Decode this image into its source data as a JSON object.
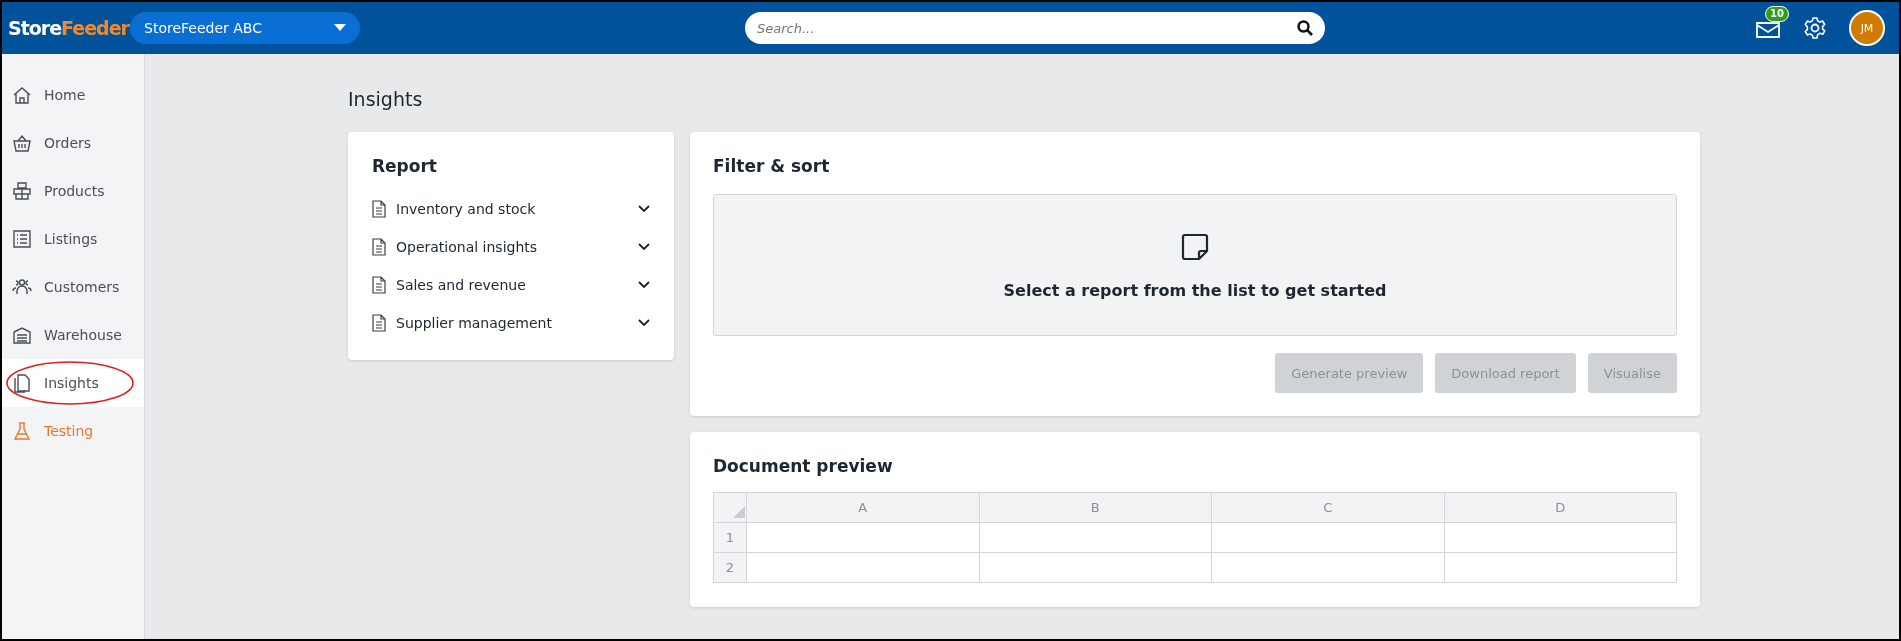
{
  "header": {
    "logo": {
      "first": "Store",
      "second": "Feeder"
    },
    "store_selector": "StoreFeeder ABC",
    "search": {
      "placeholder": "Search..."
    },
    "notifications_badge": "10",
    "avatar": "JM"
  },
  "sidebar": {
    "items": [
      {
        "label": "Home",
        "kind": "home",
        "selected": false,
        "color": "#4a4f57"
      },
      {
        "label": "Orders",
        "kind": "basket",
        "selected": false,
        "color": "#4a4f57"
      },
      {
        "label": "Products",
        "kind": "boxes",
        "selected": false,
        "color": "#4a4f57"
      },
      {
        "label": "Listings",
        "kind": "list",
        "selected": false,
        "color": "#4a4f57"
      },
      {
        "label": "Customers",
        "kind": "people",
        "selected": false,
        "color": "#4a4f57"
      },
      {
        "label": "Warehouse",
        "kind": "warehouse",
        "selected": false,
        "color": "#4a4f57"
      },
      {
        "label": "Insights",
        "kind": "pages",
        "selected": true,
        "color": "#4a4f57"
      },
      {
        "label": "Testing",
        "kind": "flask",
        "selected": false,
        "color": "#e8772e"
      }
    ]
  },
  "page_title": "Insights",
  "report": {
    "title": "Report",
    "items": [
      {
        "label": "Inventory and stock",
        "expanded": false
      },
      {
        "label": "Operational insights",
        "expanded": false
      },
      {
        "label": "Sales and revenue",
        "expanded": false
      },
      {
        "label": "Supplier management",
        "expanded": false
      }
    ]
  },
  "filter_sort": {
    "title": "Filter & sort",
    "empty_message": "Select a report from the list to get started",
    "buttons": [
      {
        "label": "Generate preview",
        "disabled": true
      },
      {
        "label": "Download report",
        "disabled": true
      },
      {
        "label": "Visualise",
        "disabled": true
      }
    ]
  },
  "document_preview": {
    "title": "Document preview",
    "columns": [
      "A",
      "B",
      "C",
      "D"
    ],
    "rows": [
      "1",
      "2"
    ]
  }
}
